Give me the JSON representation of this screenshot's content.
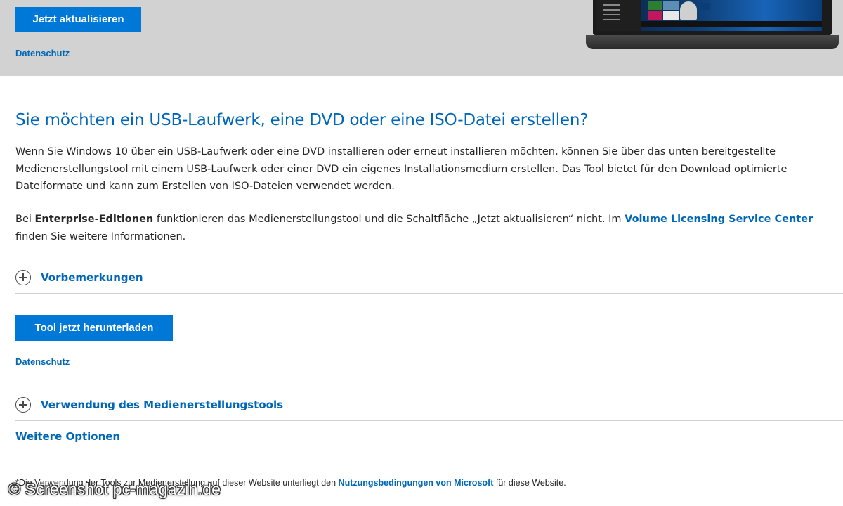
{
  "hero": {
    "update_button": "Jetzt aktualisieren",
    "privacy_link": "Datenschutz"
  },
  "section": {
    "heading": "Sie möchten ein USB-Laufwerk, eine DVD oder eine ISO-Datei erstellen?",
    "paragraph1": "Wenn Sie Windows 10 über ein USB-Laufwerk oder eine DVD installieren oder erneut installieren möchten, können Sie über das unten bereitgestellte Medienerstellungstool mit einem USB-Laufwerk oder einer DVD ein eigenes Installationsmedium erstellen. Das Tool bietet für den Download optimierte Dateiformate und kann zum Erstellen von ISO-Dateien verwendet werden.",
    "paragraph2": {
      "part1": "Bei ",
      "bold": "Enterprise-Editionen",
      "part2": " funktionieren das Medienerstellungstool und die Schaltfläche „Jetzt aktualisieren“ nicht. Im ",
      "link": "Volume Licensing Service Center",
      "part3": " finden Sie weitere Informationen."
    }
  },
  "expanders": {
    "prereq": "Vorbemerkungen",
    "usage": "Verwendung des Medienerstellungstools"
  },
  "download": {
    "button": "Tool jetzt herunterladen",
    "privacy_link": "Datenschutz"
  },
  "more_options": "Weitere Optionen",
  "footer": {
    "text_before": "*Die Verwendung der Tools zur Medienerstellung auf dieser Website unterliegt den ",
    "link": "Nutzungsbedingungen von Microsoft",
    "text_after": " für diese Website."
  },
  "watermark": "© Screenshot pc-magazin.de",
  "colors": {
    "accent": "#0078d7",
    "link": "#0067b8",
    "hero_background": "#d2d2d2"
  },
  "icons": {
    "expand": "plus-circle-icon"
  }
}
